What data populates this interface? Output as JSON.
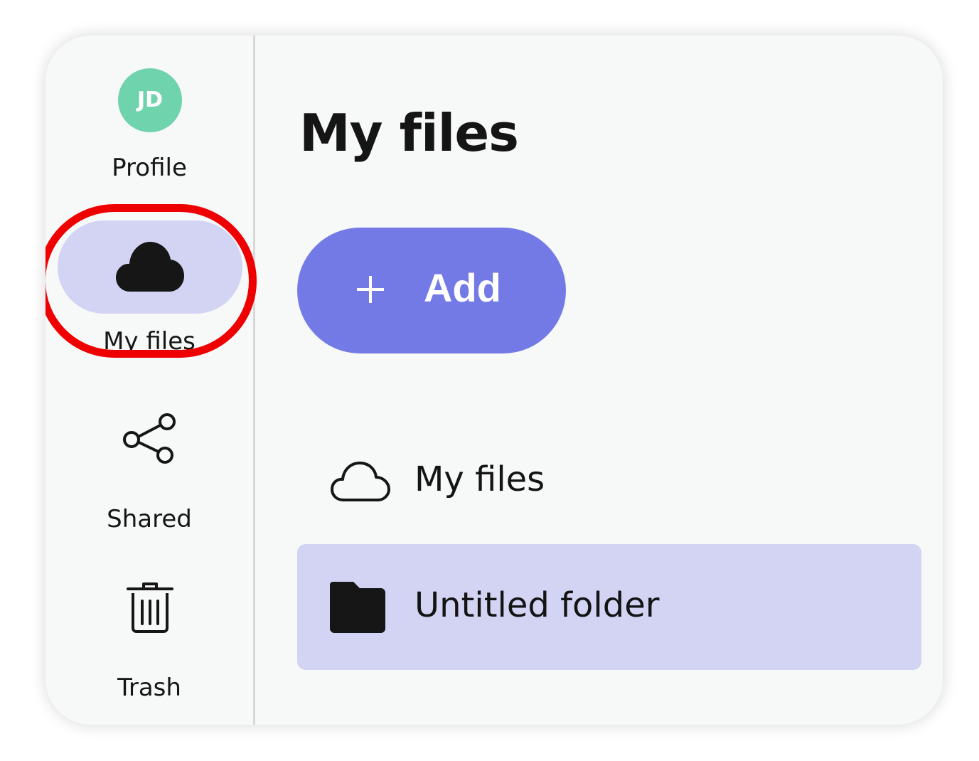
{
  "sidebar": {
    "profile": {
      "initials": "JD",
      "label": "Profile"
    },
    "my_files": {
      "label": "My files"
    },
    "shared": {
      "label": "Shared"
    },
    "trash": {
      "label": "Trash"
    }
  },
  "main": {
    "title": "My files",
    "add_button": {
      "label": "Add"
    },
    "items": [
      {
        "label": "My files",
        "icon": "cloud-outline-icon"
      },
      {
        "label": "Untitled folder",
        "icon": "folder-icon"
      }
    ]
  },
  "colors": {
    "accent": "#737ae6",
    "selection": "#d3d4f3",
    "avatar": "#6fd3ad",
    "highlight_ring": "#ef0000"
  }
}
